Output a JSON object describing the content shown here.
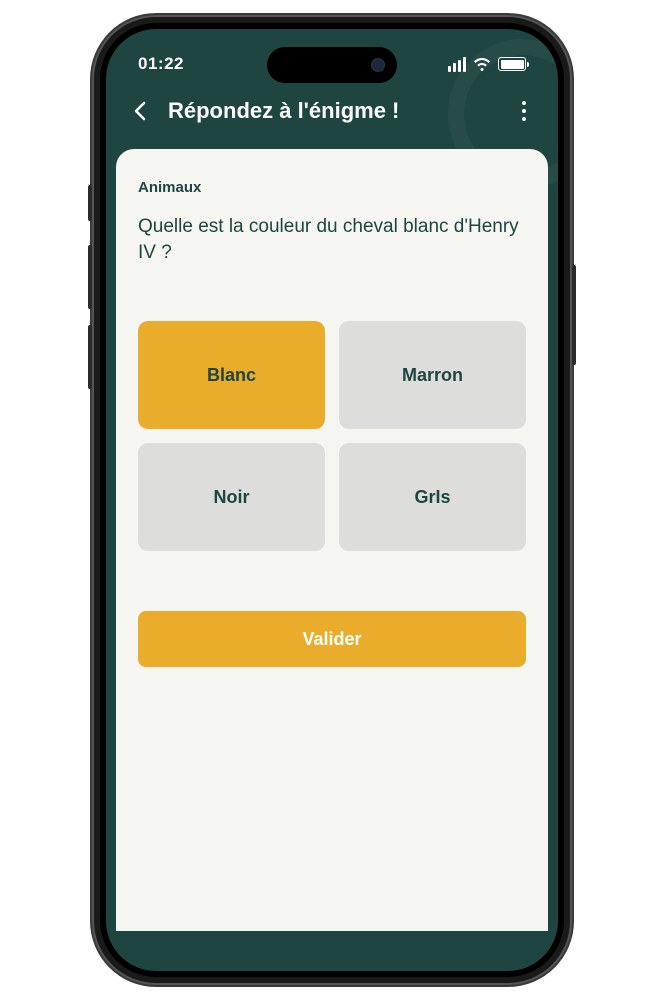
{
  "statusBar": {
    "time": "01:22"
  },
  "header": {
    "title": "Répondez à l'énigme !"
  },
  "card": {
    "category": "Animaux",
    "question": "Quelle est la couleur du cheval blanc d'Henry IV ?",
    "options": [
      {
        "label": "Blanc",
        "selected": true
      },
      {
        "label": "Marron",
        "selected": false
      },
      {
        "label": "Noir",
        "selected": false
      },
      {
        "label": "GrIs",
        "selected": false
      }
    ],
    "validateLabel": "Valider"
  },
  "colors": {
    "headerBg": "#1f4541",
    "accent": "#e9ac2b",
    "optionBg": "#dddddb",
    "cardBg": "#f5f5f2"
  }
}
